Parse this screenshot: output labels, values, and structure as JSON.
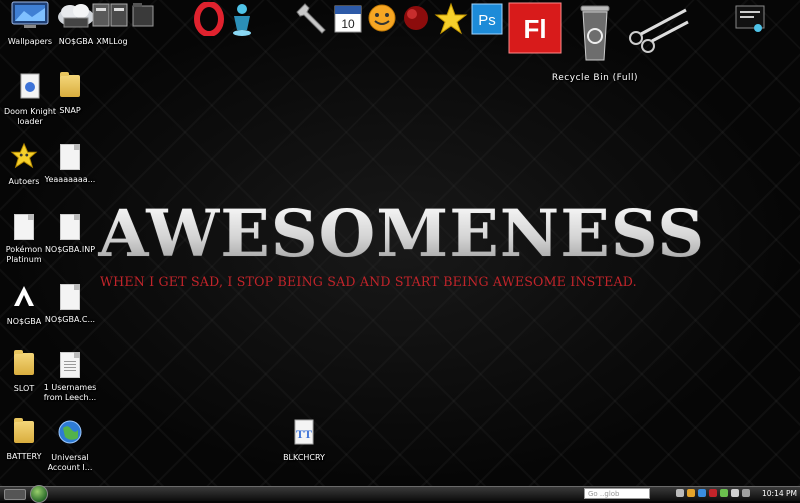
{
  "wallpaper": {
    "headline": "AWESOMENESS",
    "tagline": "WHEN I GET SAD, I STOP BEING SAD AND START BEING AWESOME INSTEAD."
  },
  "top_icons": {
    "wallpapers": "Wallpapers",
    "nosgba": "NO$GBA",
    "xmllog": "XMLLog",
    "recycle_bin": "Recycle Bin (Full)"
  },
  "desktop_icons": {
    "doom_knight": "Doom Knight loader",
    "snap": "SNAP",
    "autoers": "Autoers",
    "yeaaa": "Yeaaaaaaa...",
    "pokemon": "Pokémon Platinum",
    "nosgba_inp": "NO$GBA.INP",
    "nosgba2": "NO$GBA",
    "nosgba_c": "NO$GBA.C...",
    "slot": "SLOT",
    "usernames": "1 Usernames from Leech...",
    "battery": "BATTERY",
    "universal": "Universal Account I...",
    "blkchcry": "BLKCHCRY"
  },
  "taskbar": {
    "search_placeholder": "Go ..glob",
    "clock": "10:14 PM"
  },
  "icons": {
    "opera": "opera-icon",
    "figure": "figure-icon",
    "wrench": "wrench-icon",
    "calendar": "calendar-icon",
    "smiley": "smiley-icon",
    "red_ball": "red-ball-icon",
    "star": "star-icon",
    "photoshop": "photoshop-icon",
    "flash": "flash-icon",
    "scissors": "scissors-icon",
    "notes": "notes-icon"
  },
  "colors": {
    "tagline": "#c2242a",
    "photoshop": "#1d8bd8",
    "flash": "#d81b1b",
    "opera": "#e0222e"
  }
}
